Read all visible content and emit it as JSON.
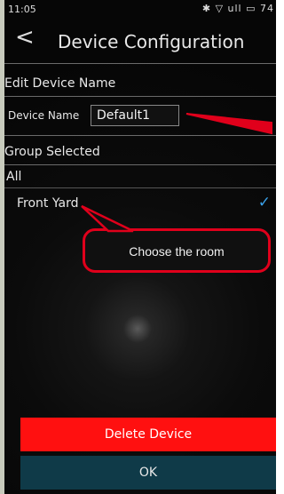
{
  "status_bar": {
    "time": "11:05",
    "icons": "✱ ▽ ull ▭ 74"
  },
  "header": {
    "back_glyph": "<",
    "title": "Device Configuration"
  },
  "edit_section": {
    "heading": "Edit Device Name",
    "field_label": "Device Name",
    "field_value": "Default1"
  },
  "group_section": {
    "heading": "Group Selected",
    "items": [
      {
        "label": "All",
        "selected": false
      },
      {
        "label": "Front Yard",
        "selected": true
      }
    ]
  },
  "callout": {
    "text": "Choose the room",
    "color": "#e0001b"
  },
  "buttons": {
    "delete_label": "Delete Device",
    "ok_label": "OK",
    "delete_color": "#ff1010",
    "ok_color": "#0f3a48"
  },
  "accent_check_color": "#3aa0e8"
}
